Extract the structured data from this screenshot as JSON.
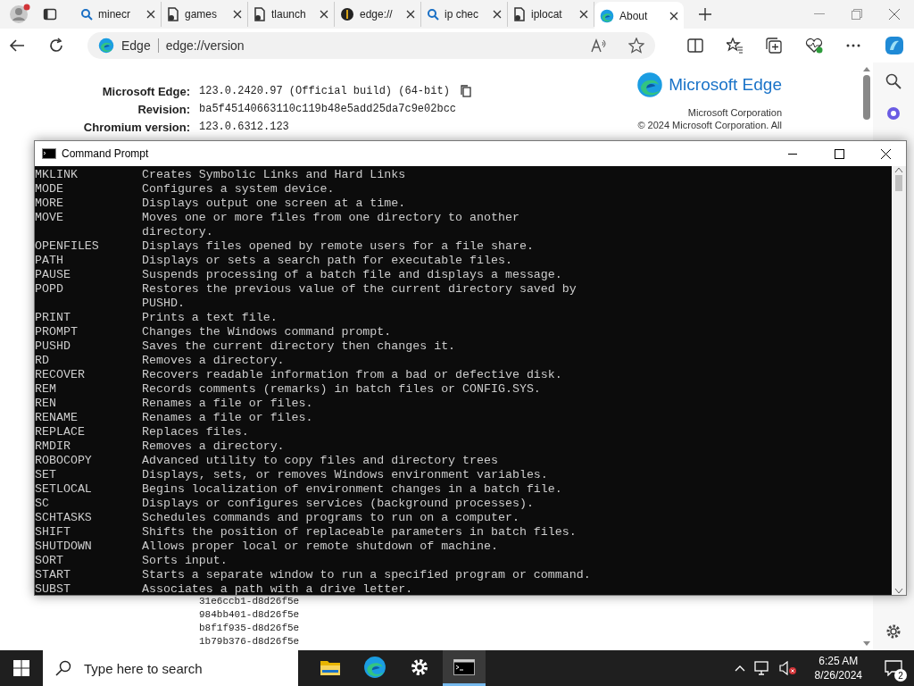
{
  "browser": {
    "tabs": [
      {
        "label": "minecr",
        "kind": "search",
        "selected": false
      },
      {
        "label": "games",
        "kind": "document",
        "selected": false
      },
      {
        "label": "tlaunch",
        "kind": "document",
        "selected": false
      },
      {
        "label": "edge://",
        "kind": "dark",
        "selected": false
      },
      {
        "label": "ip chec",
        "kind": "search",
        "selected": false
      },
      {
        "label": "iplocat",
        "kind": "document",
        "selected": false
      },
      {
        "label": "About",
        "kind": "edge",
        "selected": true
      }
    ],
    "address": {
      "site": "Edge",
      "url": "edge://version"
    },
    "version_info": [
      {
        "label": "Microsoft Edge:",
        "value": "123.0.2420.97 (Official build) (64-bit)"
      },
      {
        "label": "Revision:",
        "value": "ba5f45140663110c119b48e5add25da7c9e02bcc"
      },
      {
        "label": "Chromium version:",
        "value": "123.0.6312.123"
      }
    ],
    "brand": {
      "name": "Microsoft Edge",
      "company": "Microsoft Corporation",
      "copyright": "© 2024 Microsoft Corporation. All"
    },
    "hashes": [
      "31e6ccb1-d8d26f5e",
      "984bb401-d8d26f5e",
      "b8f1f935-d8d26f5e",
      "1b79b376-d8d26f5e"
    ]
  },
  "command_prompt": {
    "title": "Command Prompt",
    "rows": [
      {
        "command": "MKLINK",
        "lines": [
          "Creates Symbolic Links and Hard Links"
        ]
      },
      {
        "command": "MODE",
        "lines": [
          "Configures a system device."
        ]
      },
      {
        "command": "MORE",
        "lines": [
          "Displays output one screen at a time."
        ]
      },
      {
        "command": "MOVE",
        "lines": [
          "Moves one or more files from one directory to another",
          "directory."
        ]
      },
      {
        "command": "OPENFILES",
        "lines": [
          "Displays files opened by remote users for a file share."
        ]
      },
      {
        "command": "PATH",
        "lines": [
          "Displays or sets a search path for executable files."
        ]
      },
      {
        "command": "PAUSE",
        "lines": [
          "Suspends processing of a batch file and displays a message."
        ]
      },
      {
        "command": "POPD",
        "lines": [
          "Restores the previous value of the current directory saved by",
          "PUSHD."
        ]
      },
      {
        "command": "PRINT",
        "lines": [
          "Prints a text file."
        ]
      },
      {
        "command": "PROMPT",
        "lines": [
          "Changes the Windows command prompt."
        ]
      },
      {
        "command": "PUSHD",
        "lines": [
          "Saves the current directory then changes it."
        ]
      },
      {
        "command": "RD",
        "lines": [
          "Removes a directory."
        ]
      },
      {
        "command": "RECOVER",
        "lines": [
          "Recovers readable information from a bad or defective disk."
        ]
      },
      {
        "command": "REM",
        "lines": [
          "Records comments (remarks) in batch files or CONFIG.SYS."
        ]
      },
      {
        "command": "REN",
        "lines": [
          "Renames a file or files."
        ]
      },
      {
        "command": "RENAME",
        "lines": [
          "Renames a file or files."
        ]
      },
      {
        "command": "REPLACE",
        "lines": [
          "Replaces files."
        ]
      },
      {
        "command": "RMDIR",
        "lines": [
          "Removes a directory."
        ]
      },
      {
        "command": "ROBOCOPY",
        "lines": [
          "Advanced utility to copy files and directory trees"
        ]
      },
      {
        "command": "SET",
        "lines": [
          "Displays, sets, or removes Windows environment variables."
        ]
      },
      {
        "command": "SETLOCAL",
        "lines": [
          "Begins localization of environment changes in a batch file."
        ]
      },
      {
        "command": "SC",
        "lines": [
          "Displays or configures services (background processes)."
        ]
      },
      {
        "command": "SCHTASKS",
        "lines": [
          "Schedules commands and programs to run on a computer."
        ]
      },
      {
        "command": "SHIFT",
        "lines": [
          "Shifts the position of replaceable parameters in batch files."
        ]
      },
      {
        "command": "SHUTDOWN",
        "lines": [
          "Allows proper local or remote shutdown of machine."
        ]
      },
      {
        "command": "SORT",
        "lines": [
          "Sorts input."
        ]
      },
      {
        "command": "START",
        "lines": [
          "Starts a separate window to run a specified program or command."
        ]
      },
      {
        "command": "SUBST",
        "lines": [
          "Associates a path with a drive letter."
        ]
      }
    ]
  },
  "taskbar": {
    "search": {
      "placeholder": "Type here to search"
    },
    "apps": [
      {
        "kind": "folder",
        "selected": false
      },
      {
        "kind": "edge",
        "selected": false
      },
      {
        "kind": "settings",
        "selected": false
      },
      {
        "kind": "terminal",
        "selected": true
      }
    ],
    "time": "6:25 AM",
    "date": "8/26/2024",
    "notifications": "2"
  }
}
